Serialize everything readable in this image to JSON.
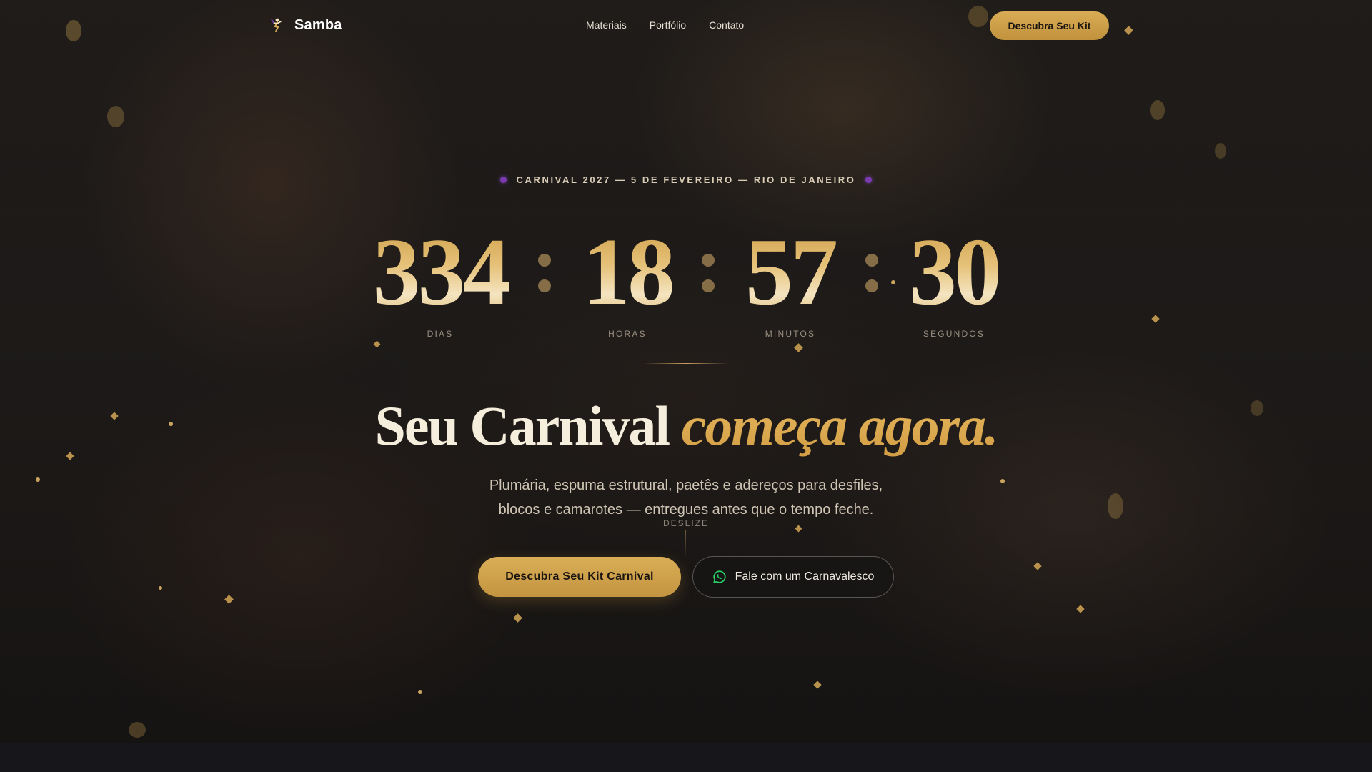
{
  "nav": {
    "brand": "Samba",
    "links": [
      "Materiais",
      "Portfólio",
      "Contato"
    ],
    "cta": "Descubra Seu Kit"
  },
  "hero": {
    "eyebrow": "CARNIVAL 2027 — 5 DE FEVEREIRO — RIO DE JANEIRO",
    "countdown": [
      {
        "value": "334",
        "label": "DIAS"
      },
      {
        "value": "18",
        "label": "HORAS"
      },
      {
        "value": "57",
        "label": "MINUTOS"
      },
      {
        "value": "30",
        "label": "SEGUNDOS"
      }
    ],
    "headline_plain": "Seu Carnival",
    "headline_accent": "começa agora.",
    "subtitle_line1": "Plumária, espuma estrutural, paetês e adereços para desfiles,",
    "subtitle_line2": "blocos e camarotes — entregues antes que o tempo feche.",
    "scroll_hint": "DESLIZE",
    "primary_button": "Descubra Seu Kit Carnival",
    "secondary_button": "Fale com um Carnavalesco"
  },
  "colors": {
    "accent_gold": "#d4a24c",
    "eyebrow_dot": "#7b3bb0",
    "whatsapp_green": "#25d366",
    "background": "#16161a"
  },
  "icons": {
    "brand": "dancer-icon",
    "secondary_button": "whatsapp-icon"
  }
}
